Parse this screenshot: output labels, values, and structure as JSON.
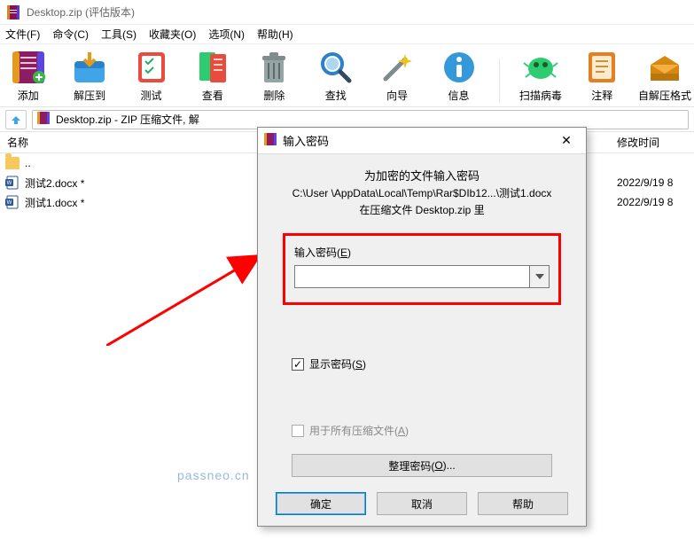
{
  "window": {
    "title": "Desktop.zip (评估版本)"
  },
  "menu": {
    "file": "文件(F)",
    "command": "命令(C)",
    "tools": "工具(S)",
    "favorites": "收藏夹(O)",
    "options": "选项(N)",
    "help": "帮助(H)"
  },
  "toolbar": {
    "add": "添加",
    "extract": "解压到",
    "test": "测试",
    "view": "查看",
    "delete": "删除",
    "find": "查找",
    "wizard": "向导",
    "info": "信息",
    "scan": "扫描病毒",
    "comment": "注释",
    "sfx": "自解压格式"
  },
  "pathbar": {
    "text": "Desktop.zip - ZIP 压缩文件, 解"
  },
  "columns": {
    "name": "名称",
    "mtime": "修改时间"
  },
  "rows": {
    "up": "..",
    "r1": {
      "name": "测试2.docx *",
      "mtime": "2022/9/19 8"
    },
    "r2": {
      "name": "测试1.docx *",
      "mtime": "2022/9/19 8"
    }
  },
  "dialog": {
    "title": "输入密码",
    "heading": "为加密的文件输入密码",
    "path": "C:\\User                       \\AppData\\Local\\Temp\\Rar$DIb12...\\测试1.docx",
    "inarchive": "在压缩文件 Desktop.zip 里",
    "input_label_pre": "输入密码(",
    "input_label_hot": "E",
    "input_label_post": ")",
    "showpw_pre": "显示密码(",
    "showpw_hot": "S",
    "showpw_post": ")",
    "forall_pre": "用于所有压缩文件(",
    "forall_hot": "A",
    "forall_post": ")",
    "manage_pre": "整理密码(",
    "manage_hot": "O",
    "manage_post": ")...",
    "ok": "确定",
    "cancel": "取消",
    "help": "帮助"
  },
  "watermark": "passneo.cn"
}
